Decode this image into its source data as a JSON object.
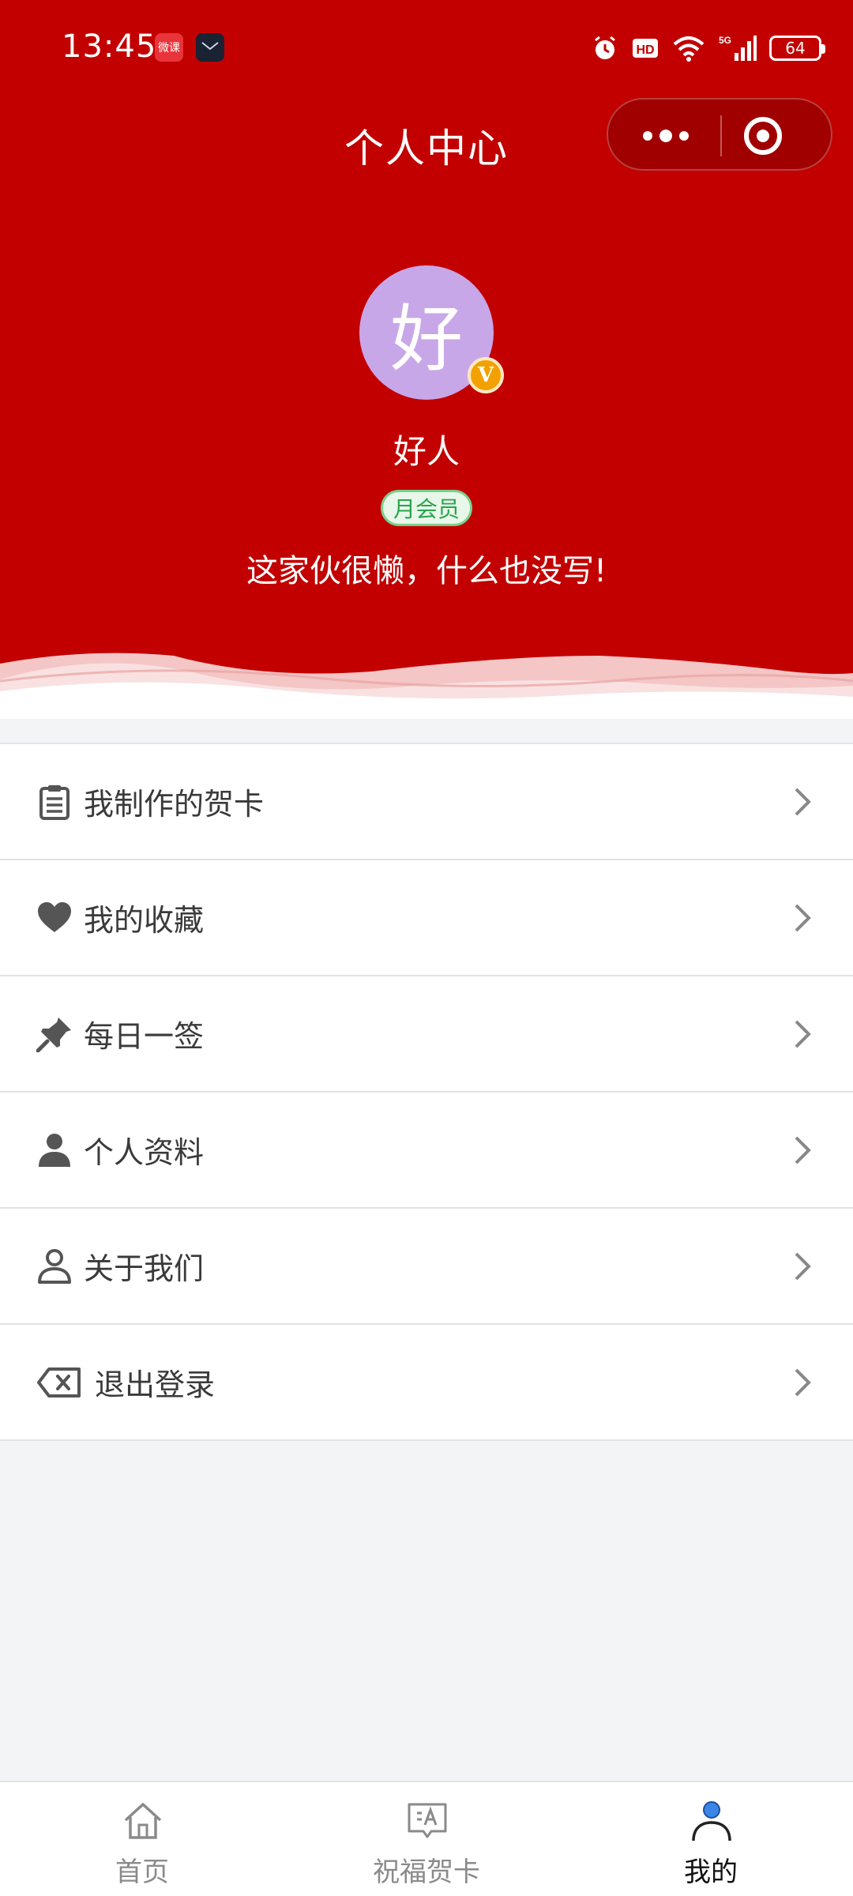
{
  "status_bar": {
    "time": "13:45",
    "app_badge_1": "微课",
    "battery": "64"
  },
  "nav": {
    "title": "个人中心"
  },
  "profile": {
    "avatar_char": "好",
    "vip_badge": "V",
    "nickname": "好人",
    "member_tag": "月会员",
    "bio": "这家伙很懒，什么也没写!"
  },
  "menu": {
    "items": [
      {
        "label": "我制作的贺卡",
        "icon": "clipboard-icon"
      },
      {
        "label": "我的收藏",
        "icon": "heart-icon"
      },
      {
        "label": "每日一签",
        "icon": "pin-icon"
      },
      {
        "label": "个人资料",
        "icon": "user-icon"
      },
      {
        "label": "关于我们",
        "icon": "user-outline-icon"
      },
      {
        "label": "退出登录",
        "icon": "backspace-icon"
      }
    ]
  },
  "tabbar": {
    "tabs": [
      {
        "label": "首页",
        "icon": "home-icon"
      },
      {
        "label": "祝福贺卡",
        "icon": "card-icon"
      },
      {
        "label": "我的",
        "icon": "user-icon",
        "active": true
      }
    ]
  },
  "colors": {
    "header_red": "#c20000",
    "avatar_bg": "#c8a7e8",
    "member_green": "#2aa34a",
    "vip_orange": "#f3a100"
  }
}
